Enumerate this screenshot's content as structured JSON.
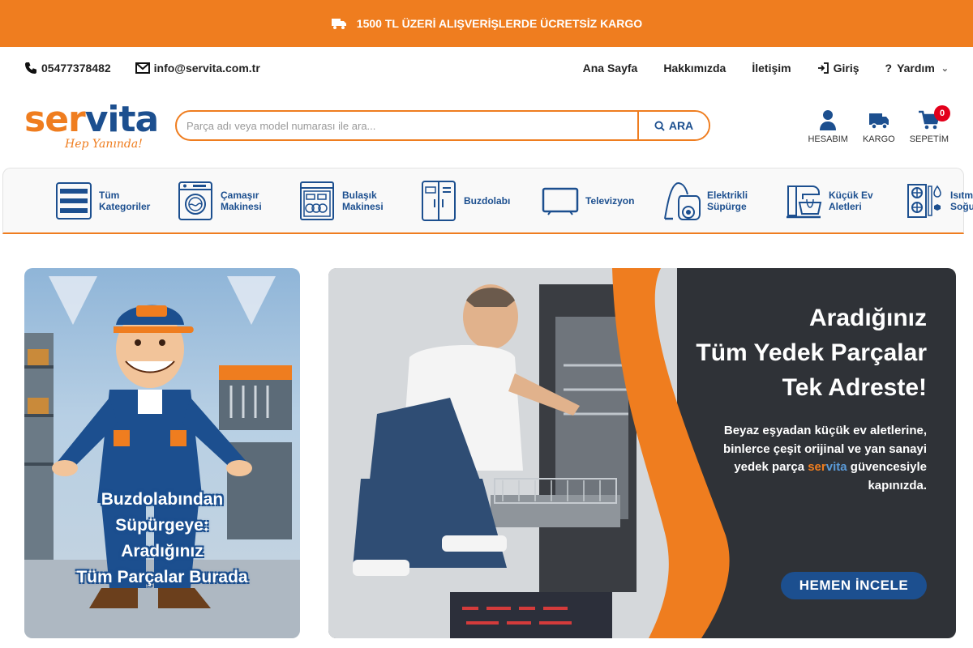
{
  "promo": {
    "text": "1500 TL ÜZERİ ALIŞVERİŞLERDE ÜCRETSİZ KARGO",
    "icon": "truck-icon"
  },
  "contact": {
    "phone": "05477378482",
    "email": "info@servita.com.tr"
  },
  "nav": [
    {
      "label": "Ana Sayfa"
    },
    {
      "label": "Hakkımızda"
    },
    {
      "label": "İletişim"
    },
    {
      "label": "Giriş",
      "icon": "login-icon"
    },
    {
      "label": "Yardım",
      "icon": "question-icon"
    }
  ],
  "logo": {
    "ser": "ser",
    "vita": "vita",
    "tagline": "Hep Yanında!"
  },
  "search": {
    "placeholder": "Parça adı veya model numarası ile ara...",
    "button": "ARA"
  },
  "header_icons": [
    {
      "label": "HESABIM",
      "icon": "user-icon"
    },
    {
      "label": "KARGO",
      "icon": "truck-icon"
    },
    {
      "label": "SEPETİM",
      "icon": "cart-icon",
      "count": "0"
    }
  ],
  "categories": [
    {
      "label": "Tüm\nKategoriler",
      "icon": "menu-icon"
    },
    {
      "label": "Çamaşır\nMakinesi",
      "icon": "washing-machine-icon"
    },
    {
      "label": "Bulaşık\nMakinesi",
      "icon": "dishwasher-icon"
    },
    {
      "label": "Buzdolabı",
      "icon": "fridge-icon"
    },
    {
      "label": "Televizyon",
      "icon": "tv-icon"
    },
    {
      "label": "Elektrikli\nSüpürge",
      "icon": "vacuum-icon"
    },
    {
      "label": "Küçük Ev\nAletleri",
      "icon": "mixer-icon"
    },
    {
      "label": "Isıtma &\nSoğutma",
      "icon": "hvac-icon"
    }
  ],
  "banner_left": {
    "caption": "Buzdolabından\nSüpürgeye:\nAradığınız\nTüm Parçalar Burada"
  },
  "banner_right": {
    "title": "Aradığınız\nTüm Yedek Parçalar\nTek Adreste!",
    "desc_1": "Beyaz eşyadan küçük ev aletlerine, binlerce çeşit orijinal ve yan sanayi yedek parça",
    "brand_ser": "ser",
    "brand_vita": "vita",
    "desc_2": "güvencesiyle kapınızda.",
    "cta": "HEMEN İNCELE"
  },
  "colors": {
    "accent": "#ef7d1f",
    "brand_blue": "#1c4f8f",
    "banner_dark": "#2f3237"
  }
}
